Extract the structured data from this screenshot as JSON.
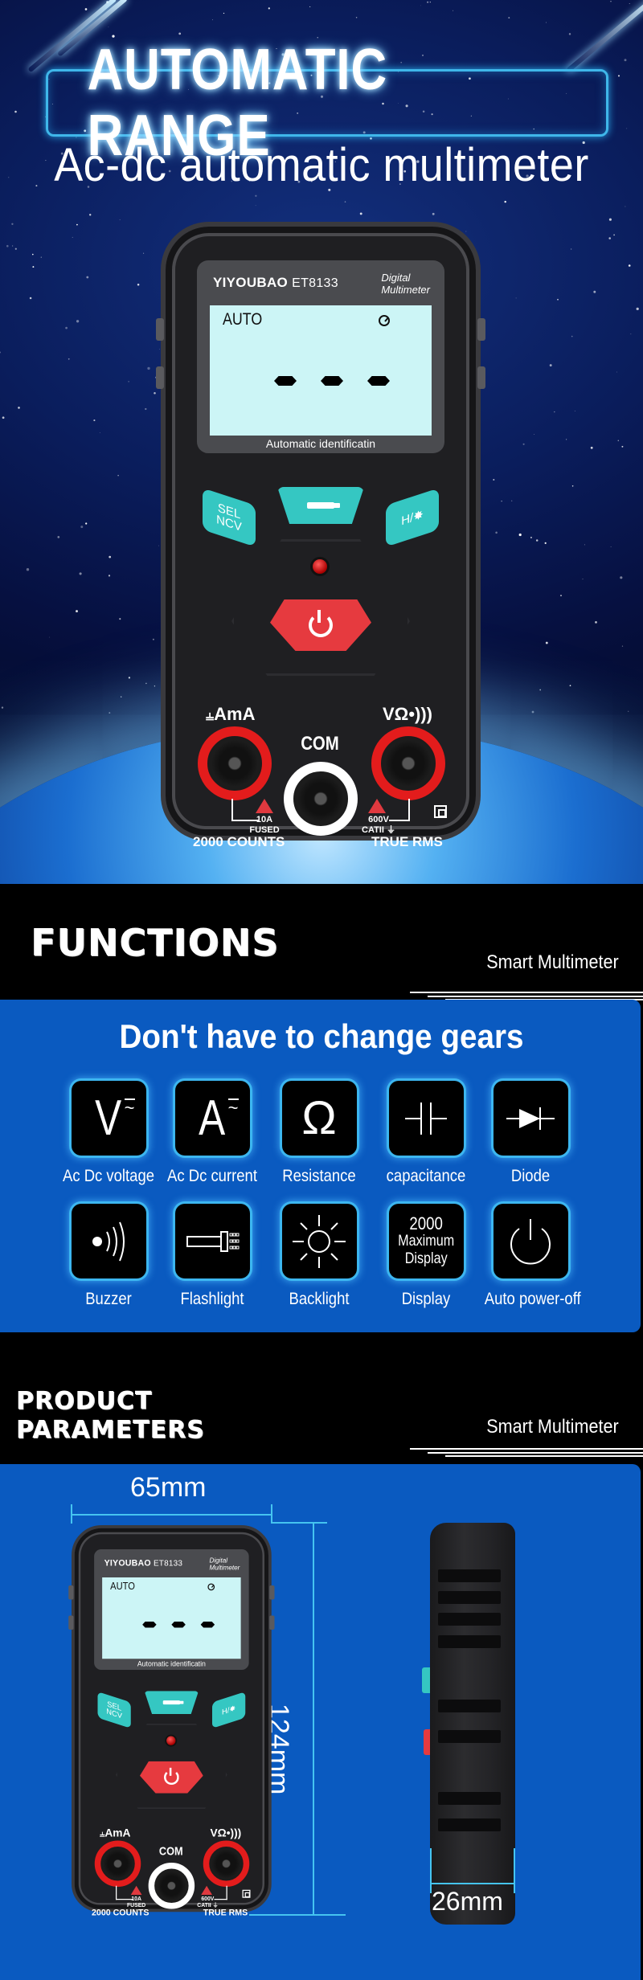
{
  "hero": {
    "title": "AUTOMATIC RANGE",
    "subtitle": "Ac-dc automatic multimeter"
  },
  "meter": {
    "brand": "YIYOUBAO",
    "model": "ET8133",
    "type_line1": "Digital",
    "type_line2": "Multimeter",
    "lcd_mode": "AUTO",
    "lcd_caption": "Automatic identificatin",
    "btn_sel_line1": "SEL",
    "btn_sel_line2": "NCV",
    "btn_hold": "H/",
    "btn_hold_icon": "✸",
    "left_jack_label": "AmA",
    "left_jack_symbol": "⫨",
    "right_jack_label": "VΩ•)))",
    "com_label": "COM",
    "fuse_line1": "10A",
    "fuse_line2": "FUSED",
    "counts": "2000 COUNTS",
    "volt_line1": "600V",
    "volt_line2": "CATII ⏚",
    "true_rms": "TRUE RMS"
  },
  "functions_band": {
    "title": "FUNCTIONS",
    "subtitle": "Smart Multimeter"
  },
  "functions": {
    "heading": "Don't have to change gears",
    "items": [
      {
        "label": "Ac Dc voltage",
        "icon": "ac-dc-voltage"
      },
      {
        "label": "Ac Dc current",
        "icon": "ac-dc-current"
      },
      {
        "label": "Resistance",
        "icon": "ohm"
      },
      {
        "label": "capacitance",
        "icon": "capacitor"
      },
      {
        "label": "Diode",
        "icon": "diode"
      },
      {
        "label": "Buzzer",
        "icon": "buzzer"
      },
      {
        "label": "Flashlight",
        "icon": "flashlight"
      },
      {
        "label": "Backlight",
        "icon": "sun"
      },
      {
        "label": "Display",
        "icon": "display-count"
      },
      {
        "label": "Auto power-off",
        "icon": "power"
      }
    ],
    "display_box_line1": "2000",
    "display_box_line2": "Maximum",
    "display_box_line3": "Display"
  },
  "params_band": {
    "title_line1": "PRODUCT",
    "title_line2": "PARAMETERS",
    "subtitle": "Smart Multimeter"
  },
  "params": {
    "width": "65mm",
    "height": "124mm",
    "depth": "26mm"
  },
  "colors": {
    "panel_blue": "#0a5ac0",
    "accent_teal": "#35c7c2",
    "accent_red": "#e63a3f",
    "lcd": "#ccf5f6"
  }
}
